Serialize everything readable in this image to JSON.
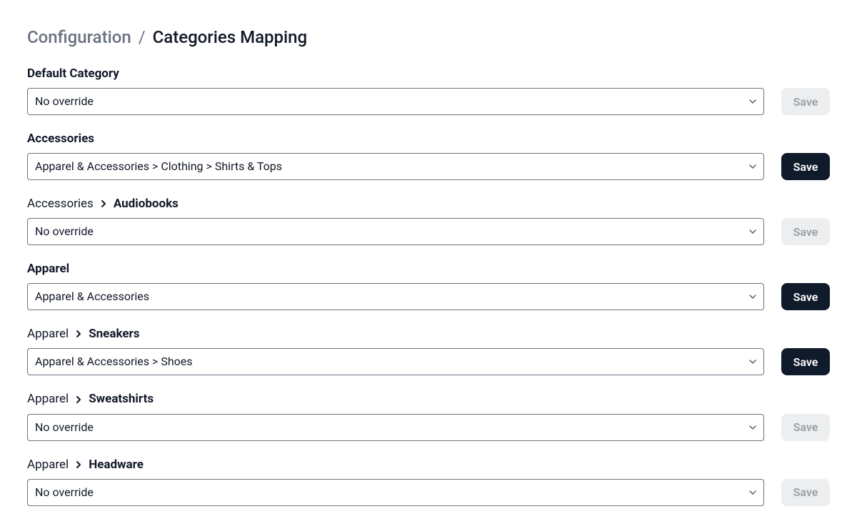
{
  "breadcrumb": {
    "parent": "Configuration",
    "separator": "/",
    "current": "Categories Mapping"
  },
  "save_label": "Save",
  "rows": {
    "0": {
      "label_trail": "",
      "label_tail": "Default Category",
      "value": "No override",
      "enabled": false
    },
    "1": {
      "label_trail": "",
      "label_tail": "Accessories",
      "value": "Apparel & Accessories > Clothing > Shirts & Tops",
      "enabled": true
    },
    "2": {
      "label_trail": "Accessories",
      "label_tail": "Audiobooks",
      "value": "No override",
      "enabled": false
    },
    "3": {
      "label_trail": "",
      "label_tail": "Apparel",
      "value": "Apparel & Accessories",
      "enabled": true
    },
    "4": {
      "label_trail": "Apparel",
      "label_tail": "Sneakers",
      "value": "Apparel & Accessories > Shoes",
      "enabled": true
    },
    "5": {
      "label_trail": "Apparel",
      "label_tail": "Sweatshirts",
      "value": "No override",
      "enabled": false
    },
    "6": {
      "label_trail": "Apparel",
      "label_tail": "Headware",
      "value": "No override",
      "enabled": false
    }
  }
}
